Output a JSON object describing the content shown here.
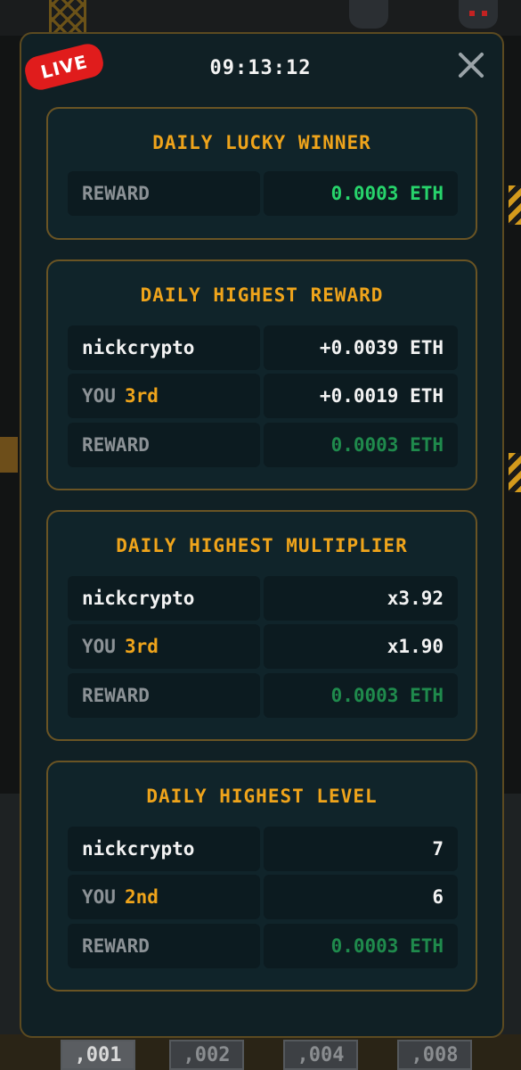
{
  "header": {
    "live_badge": "LIVE",
    "timer": "09:13:12"
  },
  "cards": [
    {
      "title": "DAILY LUCKY WINNER",
      "reward_label": "REWARD",
      "reward_value": "0.0003 ETH"
    },
    {
      "title": "DAILY HIGHEST REWARD",
      "leader": {
        "name": "nickcrypto",
        "value": "+0.0039 ETH"
      },
      "you": {
        "label": "YOU",
        "rank": "3rd",
        "value": "+0.0019 ETH"
      },
      "reward_label": "REWARD",
      "reward_value": "0.0003 ETH"
    },
    {
      "title": "DAILY HIGHEST MULTIPLIER",
      "leader": {
        "name": "nickcrypto",
        "value": "x3.92"
      },
      "you": {
        "label": "YOU",
        "rank": "3rd",
        "value": "x1.90"
      },
      "reward_label": "REWARD",
      "reward_value": "0.0003 ETH"
    },
    {
      "title": "DAILY HIGHEST LEVEL",
      "leader": {
        "name": "nickcrypto",
        "value": "7"
      },
      "you": {
        "label": "YOU",
        "rank": "2nd",
        "value": "6"
      },
      "reward_label": "REWARD",
      "reward_value": "0.0003 ETH"
    }
  ],
  "bet_chips": [
    ",001",
    ",002",
    ",004",
    ",008"
  ],
  "colors": {
    "accent": "#efa41b",
    "live": "#e01c1c",
    "reward_green": "#27d36b",
    "reward_green_dim": "#1f8a4c"
  }
}
